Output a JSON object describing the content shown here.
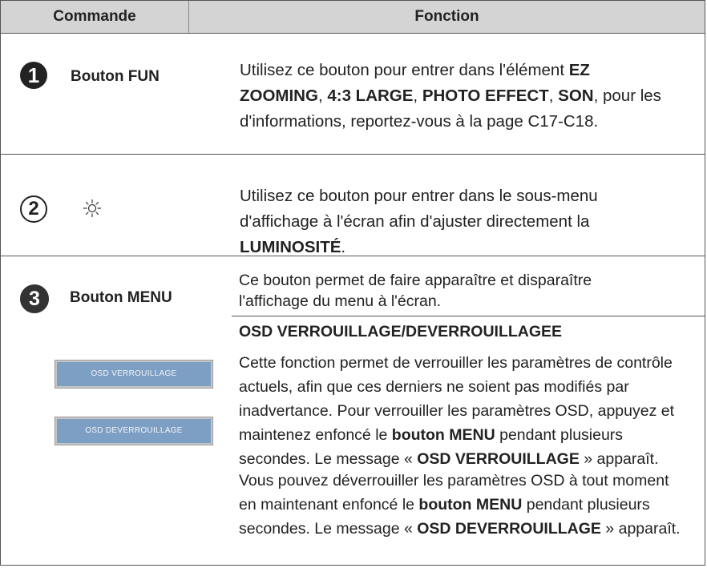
{
  "header": {
    "command": "Commande",
    "function": "Fonction"
  },
  "rows": [
    {
      "number": "1",
      "command": "Bouton FUN",
      "function_parts": [
        {
          "t": "Utilisez ce bouton pour entrer dans l'élément ",
          "b": false
        },
        {
          "t": "EZ ZOOMING",
          "b": true
        },
        {
          "t": ", ",
          "b": false
        },
        {
          "t": "4:3 LARGE",
          "b": true
        },
        {
          "t": ", ",
          "b": false
        },
        {
          "t": "PHOTO EFFECT",
          "b": true
        },
        {
          "t": ", ",
          "b": false
        },
        {
          "t": "SON",
          "b": true
        },
        {
          "t": ", pour les d'informations, reportez-vous à la page C17-C18.",
          "b": false
        }
      ]
    },
    {
      "number": "2",
      "command_icon": "sun-brightness-icon",
      "function_parts": [
        {
          "t": "Utilisez ce bouton pour entrer dans le sous-menu d'affichage à l'écran afin d'ajuster directement la ",
          "b": false
        },
        {
          "t": "LUMINOSITÉ",
          "b": true
        },
        {
          "t": ".",
          "b": false
        }
      ]
    },
    {
      "number": "3",
      "command": "Bouton MENU",
      "function_intro": "Ce bouton permet de faire apparaître et disparaître l'affichage du menu à l'écran.",
      "osd_title": "OSD VERROUILLAGE/DEVERROUILLAGEE",
      "osd_lock_parts": [
        {
          "t": "Cette fonction permet de verrouiller les paramètres de contrôle actuels, afin que ces derniers ne soient pas modifiés par inadvertance. Pour verrouiller les paramètres OSD, appuyez et maintenez enfoncé le ",
          "b": false
        },
        {
          "t": "bouton MENU",
          "b": true
        },
        {
          "t": " pendant plusieurs secondes. Le message « ",
          "b": false
        },
        {
          "t": "OSD VERROUILLAGE",
          "b": true
        },
        {
          "t": " » apparaît.",
          "b": false
        }
      ],
      "osd_unlock_parts": [
        {
          "t": "Vous pouvez déverrouiller les paramètres OSD à tout moment en maintenant enfoncé le ",
          "b": false
        },
        {
          "t": "bouton MENU",
          "b": true
        },
        {
          "t": " pendant plusieurs secondes. Le message « ",
          "b": false
        },
        {
          "t": "OSD DEVERROUILLAGE",
          "b": true
        },
        {
          "t": " » apparaît.",
          "b": false
        }
      ],
      "osd_lock_box": "OSD  VERROUILLAGE",
      "osd_unlock_box": "OSD  DEVERROUILLAGE"
    }
  ],
  "colors": {
    "header_bg": "#d4d4d4",
    "osd_box_bg": "#7e9fc4"
  }
}
